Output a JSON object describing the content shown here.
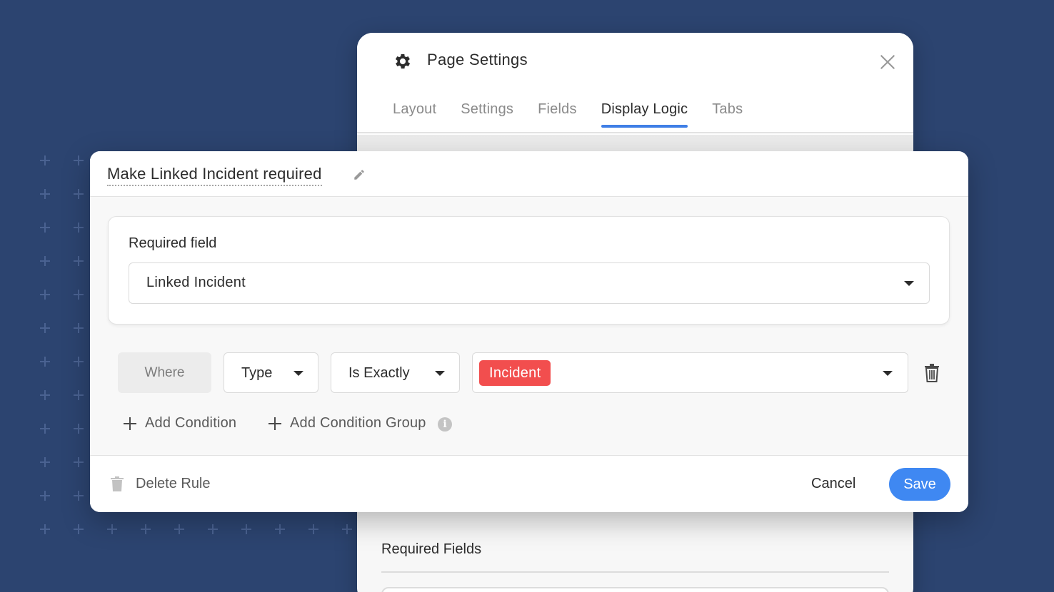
{
  "settings_panel": {
    "title": "Page Settings",
    "tabs": [
      {
        "label": "Layout",
        "active": false
      },
      {
        "label": "Settings",
        "active": false
      },
      {
        "label": "Fields",
        "active": false
      },
      {
        "label": "Display Logic",
        "active": true
      },
      {
        "label": "Tabs",
        "active": false
      }
    ],
    "required_fields_label": "Required Fields"
  },
  "rule_modal": {
    "title": "Make Linked Incident required",
    "required_field": {
      "label": "Required field",
      "value": "Linked Incident"
    },
    "condition": {
      "where_label": "Where",
      "field": "Type",
      "operator": "Is Exactly",
      "value_tag": "Incident"
    },
    "add_condition_label": "Add Condition",
    "add_condition_group_label": "Add Condition Group",
    "info_icon_glyph": "i",
    "footer": {
      "delete_label": "Delete Rule",
      "cancel_label": "Cancel",
      "save_label": "Save"
    }
  },
  "colors": {
    "background": "#2c4470",
    "accent": "#3f88f2",
    "tab_underline": "#3f7fe6",
    "tag_red": "#f24e4e"
  },
  "icons": {
    "settings": "gear-icon",
    "close": "close-icon",
    "edit": "pencil-icon",
    "dropdown": "caret-down-icon",
    "delete_condition": "trash-icon",
    "add": "plus-icon",
    "info": "info-icon"
  }
}
